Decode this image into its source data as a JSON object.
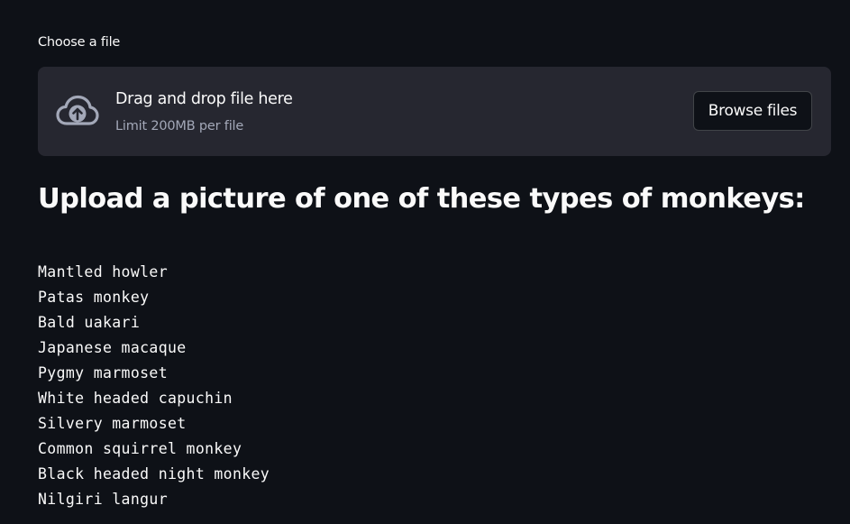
{
  "uploader": {
    "label": "Choose a file",
    "dropzone_title": "Drag and drop file here",
    "dropzone_limit": "Limit 200MB per file",
    "browse_label": "Browse files",
    "icon": "cloud-upload-icon"
  },
  "heading": "Upload a picture of one of these types of monkeys:",
  "monkeys": [
    "Mantled howler",
    "Patas monkey",
    "Bald uakari",
    "Japanese macaque",
    "Pygmy marmoset",
    "White headed capuchin",
    "Silvery marmoset",
    "Common squirrel monkey",
    "Black headed night monkey",
    "Nilgiri langur"
  ],
  "colors": {
    "background": "#0e1117",
    "dropzone_bg": "#262730",
    "text": "#fafafa",
    "muted_text": "#a3a8b8",
    "icon": "#a3a8b8"
  }
}
